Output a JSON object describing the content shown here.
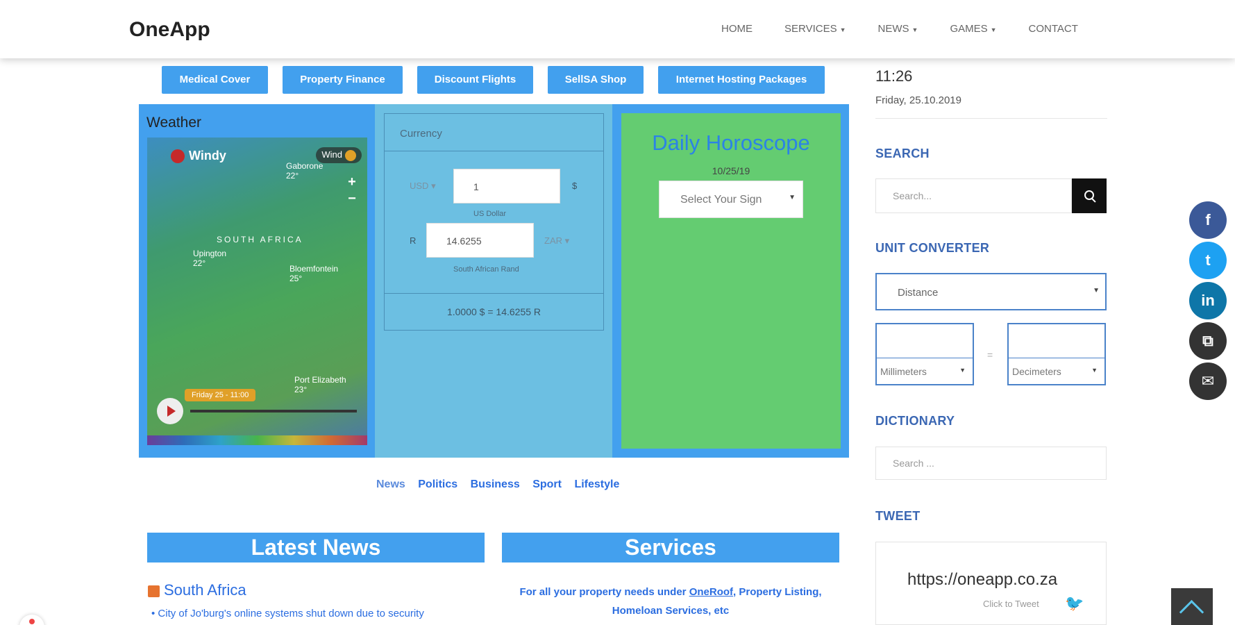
{
  "header": {
    "brand": "OneApp",
    "nav": [
      {
        "label": "HOME",
        "has_dropdown": false
      },
      {
        "label": "SERVICES",
        "has_dropdown": true
      },
      {
        "label": "NEWS",
        "has_dropdown": true
      },
      {
        "label": "GAMES",
        "has_dropdown": true
      },
      {
        "label": "CONTACT",
        "has_dropdown": false
      }
    ]
  },
  "quick_links": [
    "Medical Cover",
    "Property Finance",
    "Discount Flights",
    "SellSA Shop",
    "Internet Hosting Packages"
  ],
  "weather": {
    "title": "Weather",
    "map_brand": "Windy",
    "layer": "Wind",
    "region_label": "SOUTH AFRICA",
    "city_labels": [
      "Gaborone\n22°",
      "Upington\n22°",
      "Bloemfontein\n25°",
      "Port Elizabeth\n23°"
    ],
    "timeline_label": "Friday 25 - 11:00"
  },
  "currency": {
    "title": "Currency",
    "from_code": "USD",
    "from_value": "1",
    "from_symbol": "$",
    "from_name": "US Dollar",
    "to_symbol": "R",
    "to_value": "14.6255",
    "to_code": "ZAR",
    "to_name": "South African Rand",
    "result": "1.0000 $ = 14.6255 R"
  },
  "horoscope": {
    "title": "Daily Horoscope",
    "date": "10/25/19",
    "select_placeholder": "Select Your Sign"
  },
  "news_links": [
    "News",
    "Politics",
    "Business",
    "Sport",
    "Lifestyle"
  ],
  "latest_news": {
    "title": "Latest News",
    "region": "South Africa",
    "items": [
      "City of Jo'burg's online systems shut down due to security"
    ]
  },
  "services": {
    "title": "Services",
    "text_prefix": "For all your property needs under",
    "link": "OneRoof",
    "text_suffix": ", Property Listing, Homeloan Services, etc"
  },
  "sidebar": {
    "time": "11:26",
    "date": "Friday, 25.10.2019",
    "search_title": "SEARCH",
    "search_placeholder": "Search...",
    "unit_title": "UNIT CONVERTER",
    "unit_category": "Distance",
    "unit_from": "Millimeters",
    "unit_to": "Decimeters",
    "unit_equals": "=",
    "dictionary_title": "DICTIONARY",
    "dictionary_placeholder": "Search ...",
    "tweet_title": "TWEET",
    "tweet_url": "https://oneapp.co.za",
    "tweet_click": "Click to Tweet"
  },
  "share": [
    {
      "icon": "facebook-icon",
      "glyph": "f",
      "color": "#3b5998"
    },
    {
      "icon": "twitter-icon",
      "glyph": "t",
      "color": "#1da1f2"
    },
    {
      "icon": "linkedin-icon",
      "glyph": "in",
      "color": "#0e76a8"
    },
    {
      "icon": "copy-icon",
      "glyph": "⧉",
      "color": "#333333"
    },
    {
      "icon": "email-icon",
      "glyph": "✉",
      "color": "#333333"
    }
  ]
}
